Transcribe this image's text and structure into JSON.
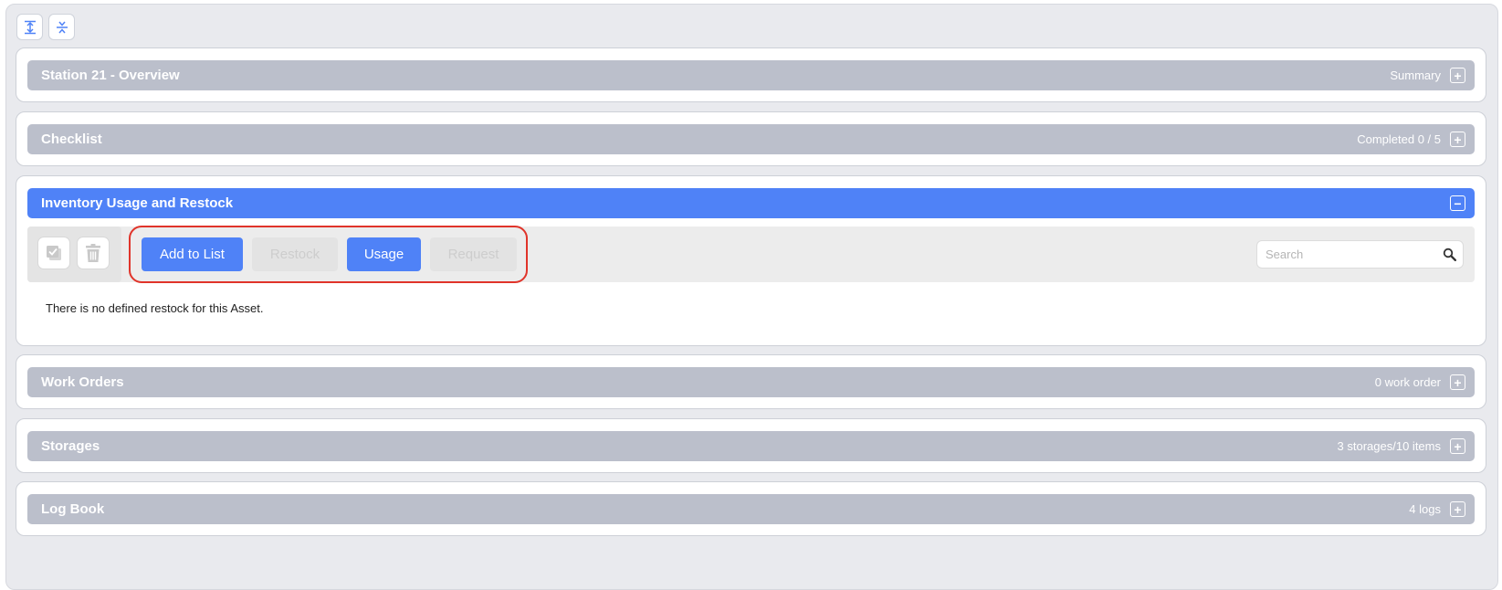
{
  "icons": {
    "expand_all": "expand-all-icon",
    "collapse_all": "collapse-all-icon",
    "select_all": "select-all-icon",
    "trash": "trash-icon",
    "search": "search-icon",
    "plus": "plus-icon",
    "minus": "minus-icon"
  },
  "colors": {
    "section_bar": "#bbbfcb",
    "active_bar": "#4f82f7",
    "primary_button": "#4f82f7",
    "highlight_outline": "#e0342a"
  },
  "sections": {
    "overview": {
      "title": "Station 21 - Overview",
      "meta": "Summary",
      "toggle": "+"
    },
    "checklist": {
      "title": "Checklist",
      "meta": "Completed 0 / 5",
      "toggle": "+"
    },
    "inventory": {
      "title": "Inventory Usage and Restock",
      "toggle": "−"
    },
    "work_orders": {
      "title": "Work Orders",
      "meta": "0 work order",
      "toggle": "+"
    },
    "storages": {
      "title": "Storages",
      "meta": "3 storages/10 items",
      "toggle": "+"
    },
    "log_book": {
      "title": "Log Book",
      "meta": "4 logs",
      "toggle": "+"
    }
  },
  "inventory": {
    "buttons": {
      "add_to_list": "Add to List",
      "restock": "Restock",
      "usage": "Usage",
      "request": "Request"
    },
    "search_placeholder": "Search",
    "empty_message": "There is no defined restock for this Asset."
  }
}
